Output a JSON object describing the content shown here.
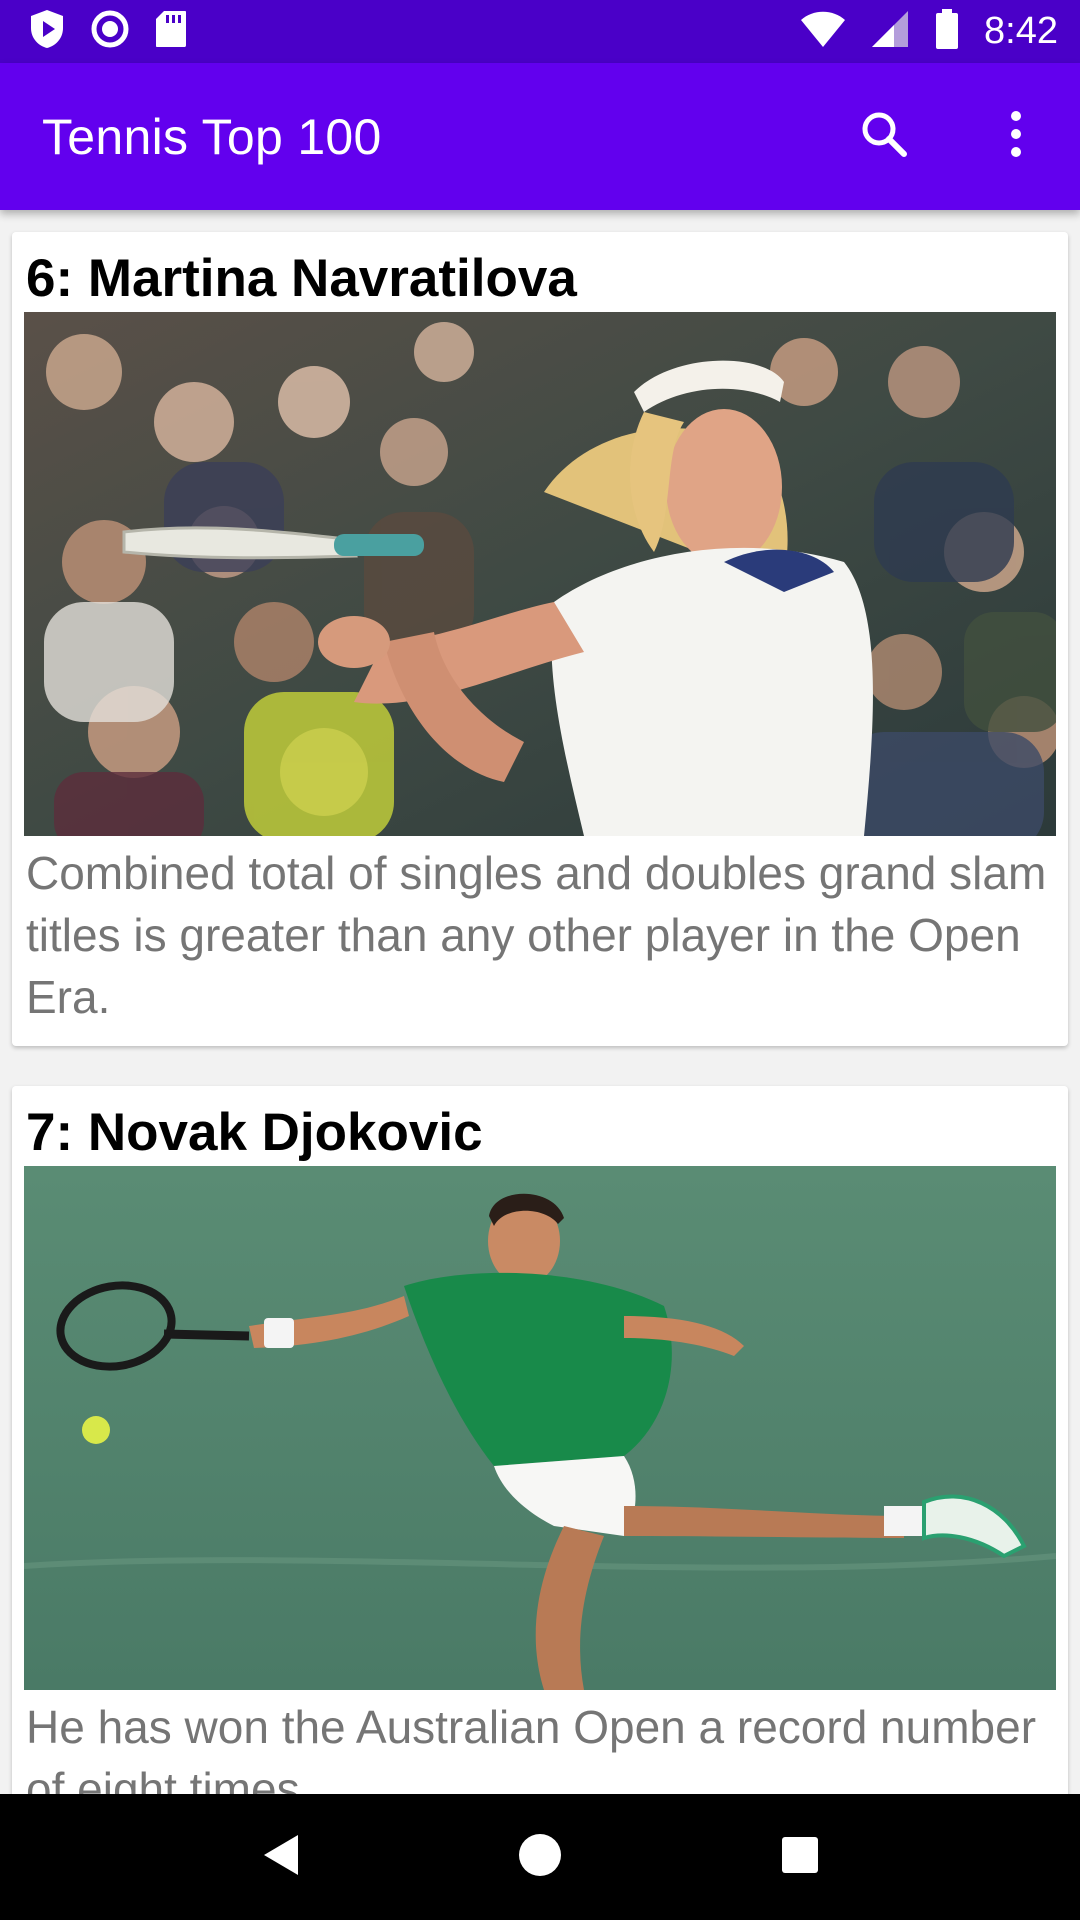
{
  "status_bar": {
    "time": "8:42",
    "left_icons": [
      "play-protect-icon",
      "circle-notification-icon",
      "sd-card-icon"
    ],
    "right_icons": [
      "wifi-icon",
      "signal-icon",
      "battery-icon"
    ]
  },
  "app_bar": {
    "title": "Tennis Top 100",
    "actions": [
      "search-icon",
      "more-vert-icon"
    ],
    "color": "#6200ee"
  },
  "cards": [
    {
      "title": "6: Martina Navratilova",
      "description": "Combined total of singles and doubles grand slam titles is greater than any other player in the Open Era."
    },
    {
      "title": "7: Novak Djokovic",
      "description": "He has won the Australian Open a record number of eight times."
    }
  ],
  "nav_bar": {
    "buttons": [
      "back-icon",
      "home-icon",
      "recents-icon"
    ]
  }
}
